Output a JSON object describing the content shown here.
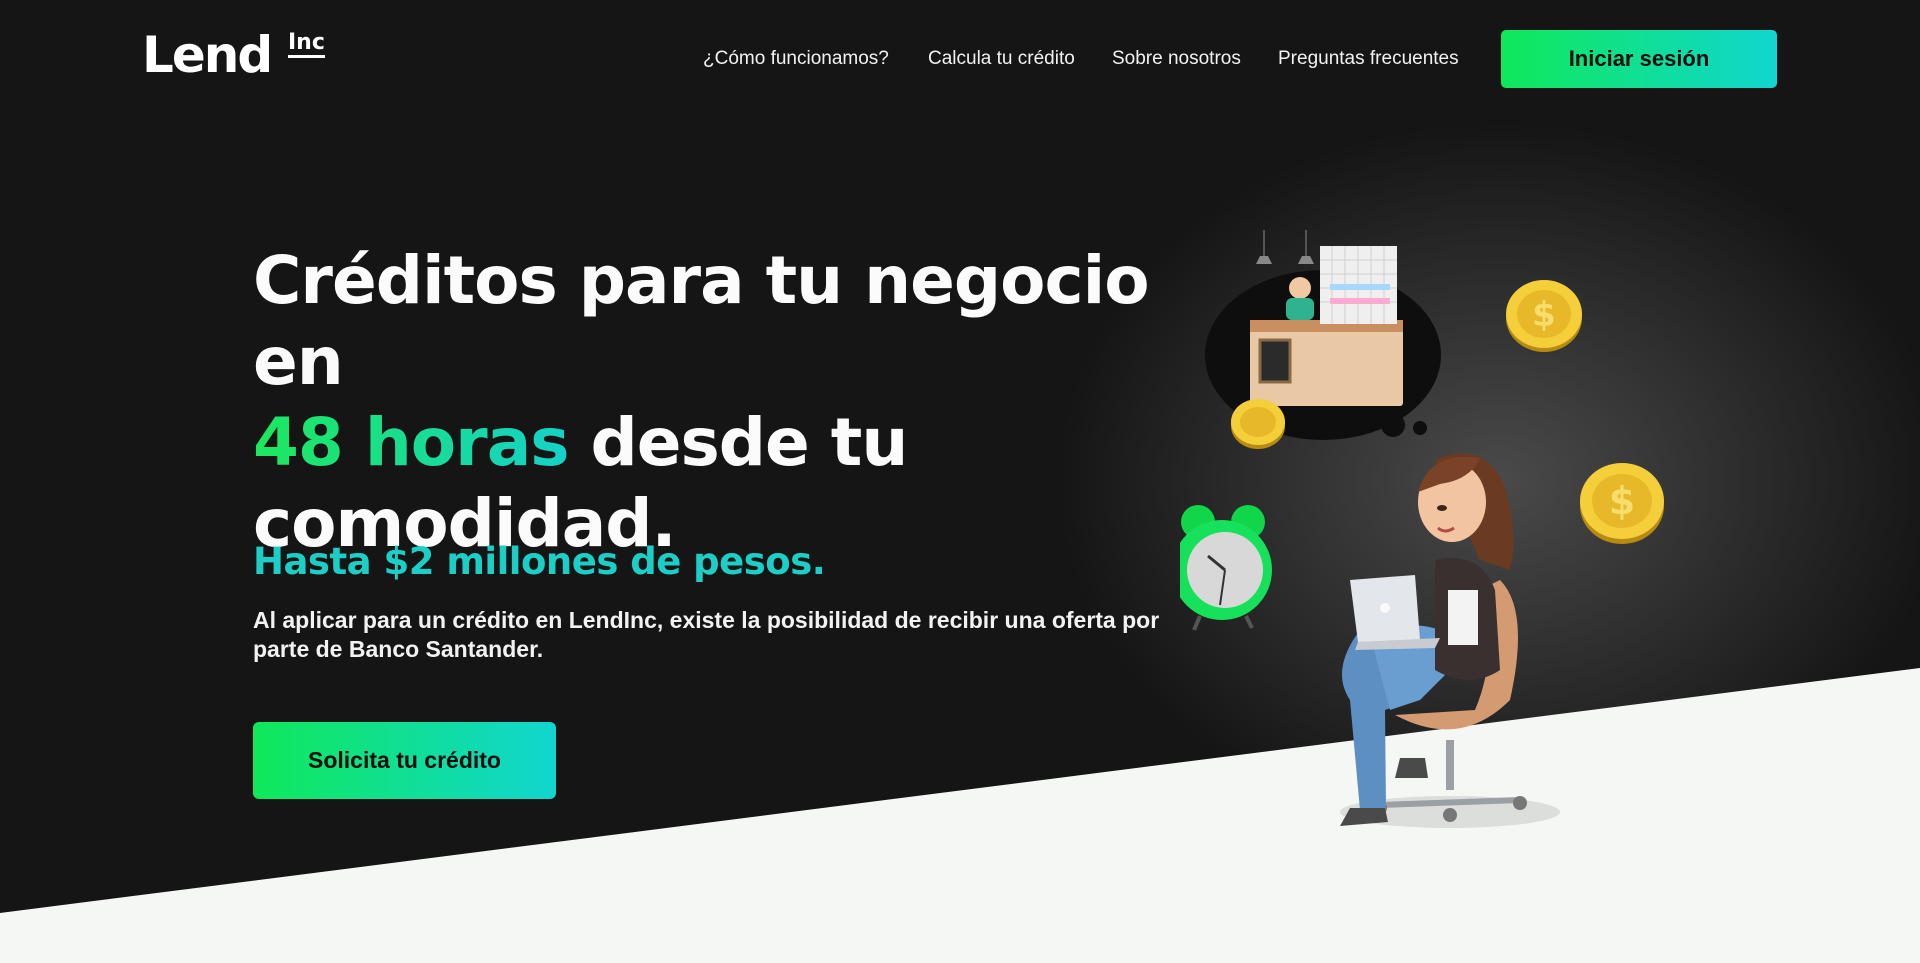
{
  "brand": {
    "name": "Lend",
    "suffix": "Inc"
  },
  "nav": {
    "links": [
      "¿Cómo funcionamos?",
      "Calcula tu crédito",
      "Sobre nosotros",
      "Preguntas frecuentes"
    ],
    "login_label": "Iniciar sesión"
  },
  "hero": {
    "headline_part1": "Créditos para tu negocio en",
    "headline_highlight": "48 horas",
    "headline_part2": "desde tu comodidad.",
    "subheadline": "Hasta $2 millones de pesos.",
    "description": "Al aplicar para un crédito en LendInc, existe la posibilidad de recibir una oferta por parte de Banco Santander.",
    "cta_label": "Solicita tu crédito"
  },
  "illustration": {
    "icons": [
      "shop-bubble-icon",
      "coin-icon",
      "alarm-clock-icon",
      "woman-laptop-icon"
    ]
  },
  "colors": {
    "accent_green": "#0fe85a",
    "accent_teal": "#11d6cf",
    "subhead_teal": "#1ccfc6",
    "dark_bg": "#151515",
    "light_bg": "#f5f7f5"
  }
}
